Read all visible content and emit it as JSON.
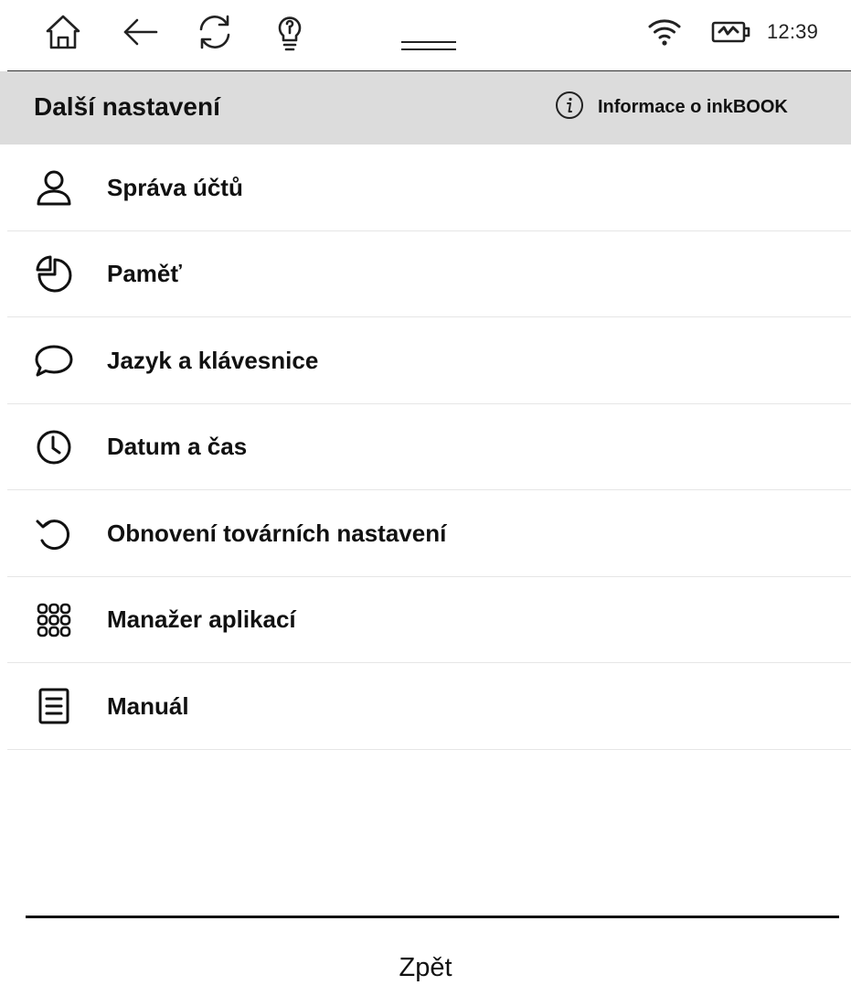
{
  "status_bar": {
    "icons": [
      "home-icon",
      "back-arrow-icon",
      "refresh-icon",
      "lightbulb-icon",
      "drag-handle-icon",
      "wifi-icon",
      "battery-charging-icon"
    ],
    "time": "12:39"
  },
  "header": {
    "title": "Další nastavení",
    "info_label": "Informace o inkBOOK",
    "info_icon": "info-icon"
  },
  "menu": {
    "items": [
      {
        "label": "Správa účtů",
        "icon": "user-icon"
      },
      {
        "label": "Paměť",
        "icon": "pie-chart-icon"
      },
      {
        "label": "Jazyk a klávesnice",
        "icon": "speech-bubble-icon"
      },
      {
        "label": "Datum a čas",
        "icon": "clock-icon"
      },
      {
        "label": "Obnovení továrních nastavení",
        "icon": "reset-icon"
      },
      {
        "label": "Manažer aplikací",
        "icon": "app-grid-icon"
      },
      {
        "label": "Manuál",
        "icon": "document-icon"
      }
    ]
  },
  "footer": {
    "back_label": "Zpět"
  }
}
